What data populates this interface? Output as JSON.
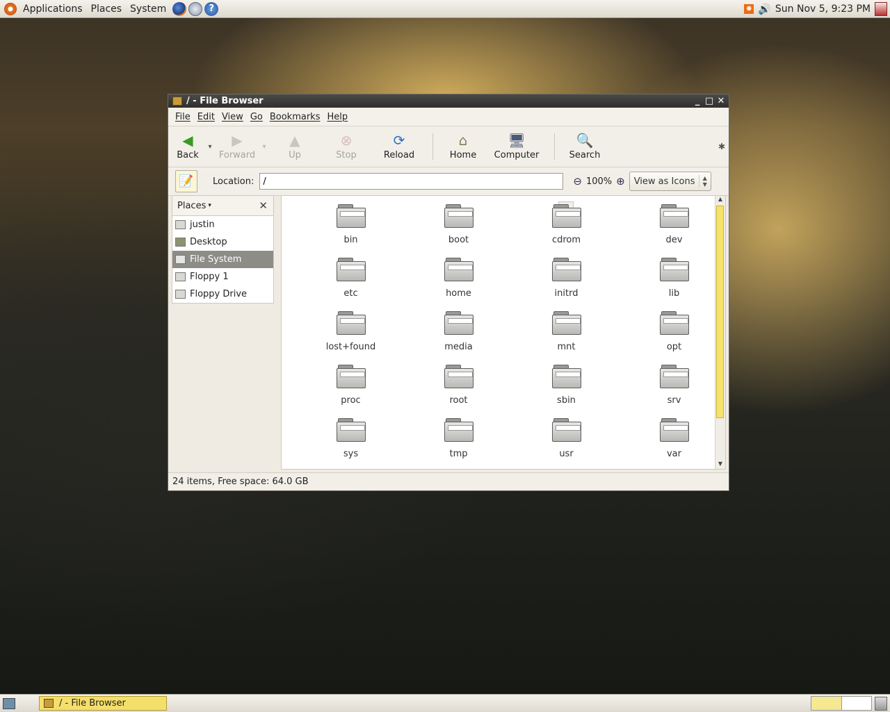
{
  "top_panel": {
    "menus": [
      "Applications",
      "Places",
      "System"
    ],
    "clock": "Sun Nov  5,  9:23 PM",
    "launchers": [
      "firefox-icon",
      "mail-icon",
      "help-icon"
    ]
  },
  "window": {
    "title": "/ - File Browser",
    "menubar": [
      "File",
      "Edit",
      "View",
      "Go",
      "Bookmarks",
      "Help"
    ],
    "toolbar": {
      "back": "Back",
      "forward": "Forward",
      "up": "Up",
      "stop": "Stop",
      "reload": "Reload",
      "home": "Home",
      "computer": "Computer",
      "search": "Search"
    },
    "location": {
      "label": "Location:",
      "value": "/",
      "zoom": "100%",
      "view_mode": "View as Icons"
    },
    "sidebar": {
      "header": "Places",
      "items": [
        {
          "label": "justin",
          "icon": "home-folder-icon"
        },
        {
          "label": "Desktop",
          "icon": "desktop-icon"
        },
        {
          "label": "File System",
          "icon": "harddisk-icon",
          "selected": true
        },
        {
          "label": "Floppy 1",
          "icon": "floppy-icon"
        },
        {
          "label": "Floppy Drive",
          "icon": "floppy-icon"
        }
      ]
    },
    "files": [
      "bin",
      "boot",
      "cdrom",
      "dev",
      "etc",
      "home",
      "initrd",
      "lib",
      "lost+found",
      "media",
      "mnt",
      "opt",
      "proc",
      "root",
      "sbin",
      "srv",
      "sys",
      "tmp",
      "usr",
      "var"
    ],
    "status": "24 items, Free space: 64.0 GB"
  },
  "bottom_panel": {
    "task": "/ - File Browser"
  },
  "colors": {
    "selection": "#8d8c87",
    "taskbar_active": "#f5df6b",
    "scroll_thumb": "#f7e36a"
  }
}
